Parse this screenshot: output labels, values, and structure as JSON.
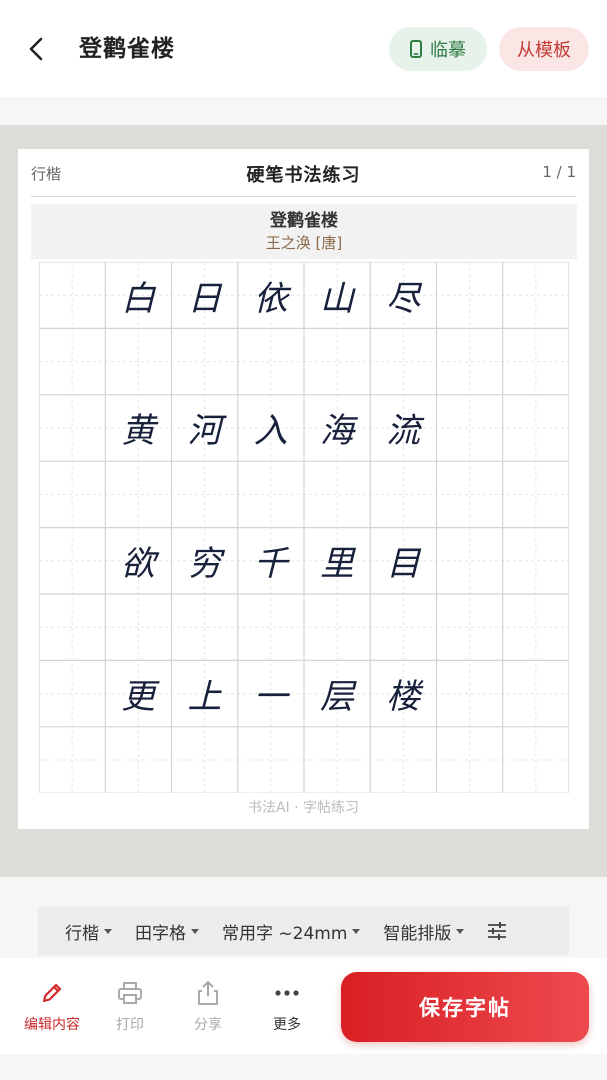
{
  "header": {
    "title": "登鹳雀楼",
    "copy_btn": "临摹",
    "template_btn": "从模板"
  },
  "paper": {
    "style_label": "行楷",
    "heading": "硬笔书法练习",
    "page": "1 / 1",
    "poem_title": "登鹳雀楼",
    "poem_author": "王之涣 [唐]",
    "watermark": "书法AI · 字帖练习",
    "lines": [
      [
        "白",
        "日",
        "依",
        "山",
        "尽"
      ],
      [
        "黄",
        "河",
        "入",
        "海",
        "流"
      ],
      [
        "欲",
        "穷",
        "千",
        "里",
        "目"
      ],
      [
        "更",
        "上",
        "一",
        "层",
        "楼"
      ]
    ]
  },
  "options": {
    "font": "行楷",
    "grid": "田字格",
    "size": "常用字 ~24mm",
    "layout": "智能排版"
  },
  "toolbar": {
    "edit": "编辑内容",
    "print": "打印",
    "share": "分享",
    "more": "更多",
    "save": "保存字帖"
  },
  "colors": {
    "accent": "#d81f24",
    "copy_green": "#2f7d45",
    "ink": "#18213b"
  }
}
